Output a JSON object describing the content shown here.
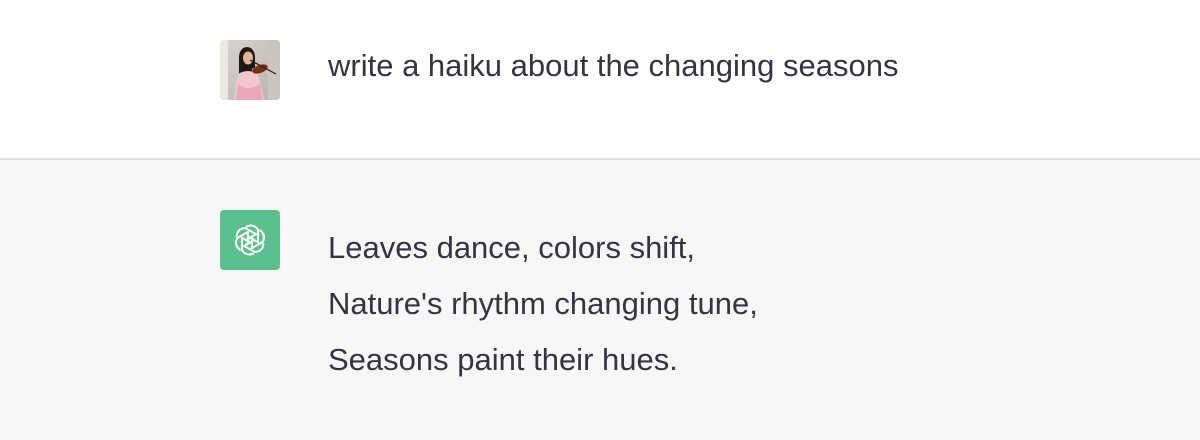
{
  "user_message": {
    "avatar_icon": "user-photo-violinist",
    "text": "write a haiku about the changing seasons"
  },
  "assistant_message": {
    "avatar_icon": "openai-logo-icon",
    "avatar_color": "#5bc18c",
    "lines": [
      "Leaves dance, colors shift,",
      "Nature's rhythm changing tune,",
      "Seasons paint their hues."
    ]
  },
  "colors": {
    "text": "#343541",
    "assistant_bg": "#f7f7f8",
    "divider": "#e3e3e6"
  }
}
